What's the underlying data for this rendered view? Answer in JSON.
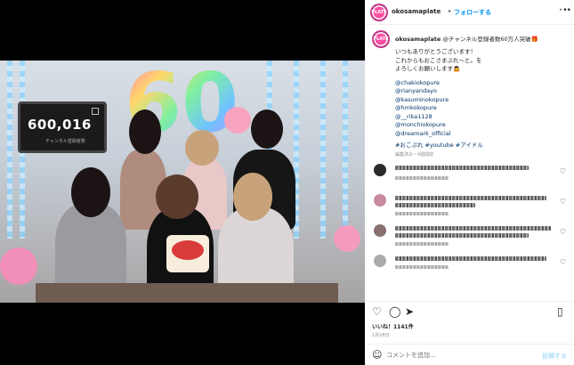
{
  "header": {
    "username": "okosamaplate",
    "separator": "•",
    "follow": "フォローする",
    "more": "•••",
    "avatar_text": "PLATE"
  },
  "caption": {
    "username": "okosamaplate",
    "title": "@チャンネル登録者数60万人突破🎁",
    "lines": [
      "いつもありがとうございます！",
      "これからもおこさまぷれ〜と。を",
      "よろしくお願いします🙇"
    ],
    "mentions": [
      "@chakiokopure",
      "@rianyandayo",
      "@kasuminokopure",
      "@hmkokopure",
      "@__rika1128",
      "@monchiokopure",
      "@dreamark_official"
    ],
    "hashtags": "#おこぷれ #youtube #アイドル",
    "meta": "編集済み・4週間前"
  },
  "media": {
    "counter_value": "600,016",
    "counter_label": "チャンネル登録者数",
    "balloon_number": "60"
  },
  "actions": {
    "like_icon": "♡",
    "comment_icon": "◯",
    "share_icon": "➤",
    "save_icon": "▯",
    "likes": "いいね！1141件",
    "date": "1月28日"
  },
  "comment_box": {
    "emoji_icon": "☺",
    "placeholder": "コメントを追加...",
    "post_label": "投稿する"
  },
  "window": {
    "close_icon": "✕"
  },
  "colors": {
    "accent": "#0095f6",
    "mention": "#00376b",
    "brand": "#ff4fa3"
  }
}
